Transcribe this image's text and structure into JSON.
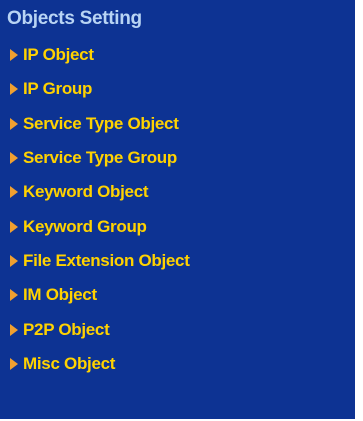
{
  "panel": {
    "title": "Objects Setting",
    "items": [
      {
        "label": "IP Object",
        "icon": "arrow-right-icon"
      },
      {
        "label": "IP Group",
        "icon": "arrow-right-icon"
      },
      {
        "label": "Service Type Object",
        "icon": "arrow-right-icon"
      },
      {
        "label": "Service Type Group",
        "icon": "arrow-right-icon"
      },
      {
        "label": "Keyword Object",
        "icon": "arrow-right-icon"
      },
      {
        "label": "Keyword Group",
        "icon": "arrow-right-icon"
      },
      {
        "label": "File Extension Object",
        "icon": "arrow-right-icon"
      },
      {
        "label": "IM Object",
        "icon": "arrow-right-icon"
      },
      {
        "label": "P2P Object",
        "icon": "arrow-right-icon"
      },
      {
        "label": "Misc Object",
        "icon": "arrow-right-icon"
      }
    ]
  },
  "colors": {
    "background": "#0d3393",
    "title": "#b8d4f4",
    "item_text": "#ffd200",
    "arrow": "#f0a030"
  }
}
